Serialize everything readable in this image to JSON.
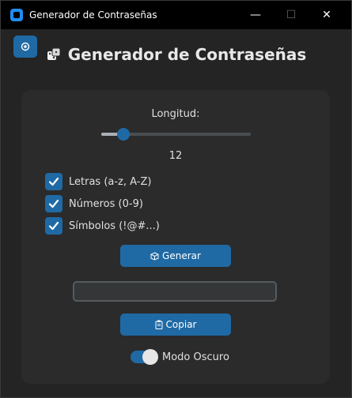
{
  "window": {
    "title": "Generador de Contraseñas",
    "minimize_icon": "minimize-icon",
    "maximize_icon": "maximize-icon",
    "close_icon": "close-icon",
    "minimize_glyph": "—",
    "maximize_glyph": "☐",
    "close_glyph": "✕"
  },
  "header": {
    "title": "Generador de Contraseñas",
    "icon": "dice-icon",
    "corner_button_icon": "theme-icon"
  },
  "length": {
    "label": "Longitud:",
    "value": "12",
    "slider_fraction": 0.15
  },
  "options": [
    {
      "label": "Letras (a-z, A-Z)",
      "checked": true
    },
    {
      "label": "Números (0-9)",
      "checked": true
    },
    {
      "label": "Símbolos (!@#...)",
      "checked": true
    }
  ],
  "buttons": {
    "generate_label": "Generar",
    "generate_icon": "dice-icon",
    "copy_label": "Copiar",
    "copy_icon": "clipboard-icon"
  },
  "output": {
    "value": ""
  },
  "dark_mode": {
    "label": "Modo Oscuro",
    "on": true
  },
  "colors": {
    "accent": "#1f6aa5",
    "background": "#242424",
    "panel": "#2b2b2b"
  }
}
